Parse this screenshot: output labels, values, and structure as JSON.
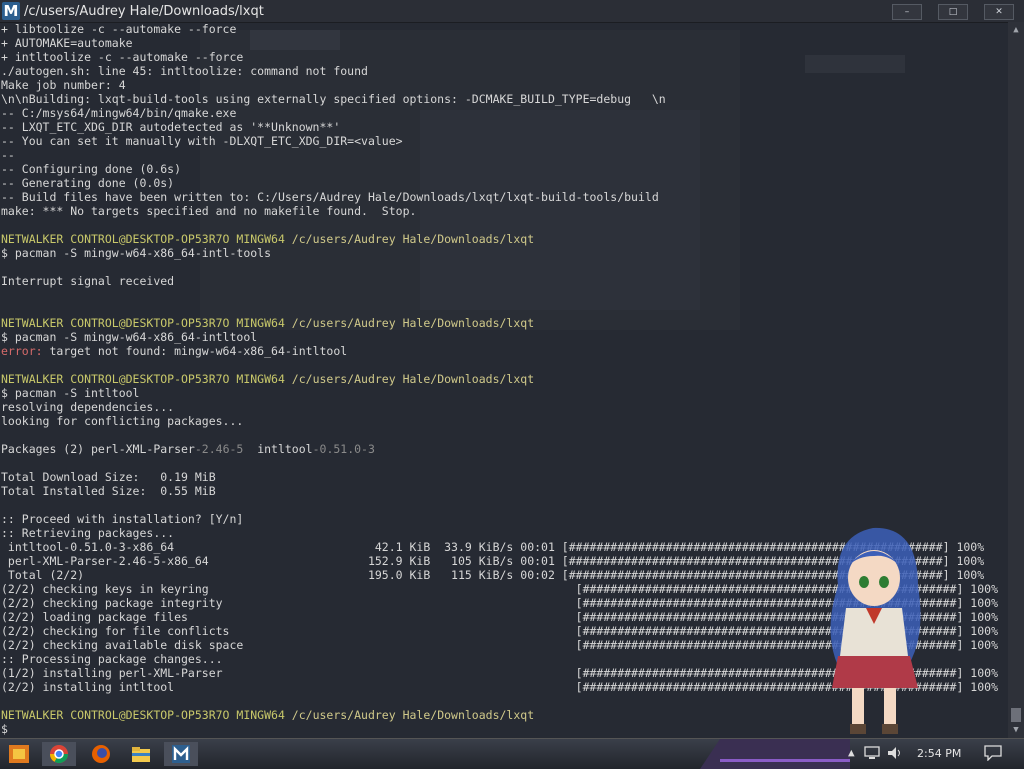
{
  "window": {
    "title": "/c/users/Audrey Hale/Downloads/lxqt",
    "logo_letter": "M",
    "minimize_label": "–",
    "maximize_label": "□",
    "close_label": "✕"
  },
  "terminal": {
    "lines": [
      {
        "segs": [
          {
            "t": "+ libtoolize -c --automake --force",
            "c": ""
          }
        ]
      },
      {
        "segs": [
          {
            "t": "+ AUTOMAKE=automake",
            "c": ""
          }
        ]
      },
      {
        "segs": [
          {
            "t": "+ intltoolize -c --automake --force",
            "c": ""
          }
        ]
      },
      {
        "segs": [
          {
            "t": "./autogen.sh: line 45: intltoolize: command not found",
            "c": ""
          }
        ]
      },
      {
        "segs": [
          {
            "t": "Make job number: 4",
            "c": ""
          }
        ]
      },
      {
        "segs": [
          {
            "t": "\\n\\nBuilding: lxqt-build-tools using externally specified options: -DCMAKE_BUILD_TYPE=debug   \\n",
            "c": ""
          }
        ]
      },
      {
        "segs": [
          {
            "t": "-- C:/msys64/mingw64/bin/qmake.exe",
            "c": ""
          }
        ]
      },
      {
        "segs": [
          {
            "t": "-- LXQT_ETC_XDG_DIR autodetected as '**Unknown**'",
            "c": ""
          }
        ]
      },
      {
        "segs": [
          {
            "t": "-- You can set it manually with -DLXQT_ETC_XDG_DIR=<value>",
            "c": ""
          }
        ]
      },
      {
        "segs": [
          {
            "t": "--",
            "c": ""
          }
        ]
      },
      {
        "segs": [
          {
            "t": "-- Configuring done (0.6s)",
            "c": ""
          }
        ]
      },
      {
        "segs": [
          {
            "t": "-- Generating done (0.0s)",
            "c": ""
          }
        ]
      },
      {
        "segs": [
          {
            "t": "-- Build files have been written to: C:/Users/Audrey Hale/Downloads/lxqt/lxqt-build-tools/build",
            "c": ""
          }
        ]
      },
      {
        "segs": [
          {
            "t": "make: *** No targets specified and no makefile found.  Stop.",
            "c": ""
          }
        ]
      },
      {
        "segs": [
          {
            "t": "",
            "c": ""
          }
        ]
      },
      {
        "segs": [
          {
            "t": "NETWALKER CONTROL@DESKTOP-OP53R7O MINGW64",
            "c": "c-prompt"
          },
          {
            "t": " /c/users/Audrey Hale/Downloads/lxqt",
            "c": "c-path"
          }
        ]
      },
      {
        "segs": [
          {
            "t": "$ pacman -S mingw-w64-x86_64-intl-tools",
            "c": ""
          }
        ]
      },
      {
        "segs": [
          {
            "t": "",
            "c": ""
          }
        ]
      },
      {
        "segs": [
          {
            "t": "Interrupt signal received",
            "c": ""
          }
        ]
      },
      {
        "segs": [
          {
            "t": "",
            "c": ""
          }
        ]
      },
      {
        "segs": [
          {
            "t": "",
            "c": ""
          }
        ]
      },
      {
        "segs": [
          {
            "t": "NETWALKER CONTROL@DESKTOP-OP53R7O MINGW64",
            "c": "c-prompt"
          },
          {
            "t": " /c/users/Audrey Hale/Downloads/lxqt",
            "c": "c-path"
          }
        ]
      },
      {
        "segs": [
          {
            "t": "$ pacman -S mingw-w64-x86_64-intltool",
            "c": ""
          }
        ]
      },
      {
        "segs": [
          {
            "t": "error:",
            "c": "c-err"
          },
          {
            "t": " target not found: mingw-w64-x86_64-intltool",
            "c": ""
          }
        ]
      },
      {
        "segs": [
          {
            "t": "",
            "c": ""
          }
        ]
      },
      {
        "segs": [
          {
            "t": "NETWALKER CONTROL@DESKTOP-OP53R7O MINGW64",
            "c": "c-prompt"
          },
          {
            "t": " /c/users/Audrey Hale/Downloads/lxqt",
            "c": "c-path"
          }
        ]
      },
      {
        "segs": [
          {
            "t": "$ pacman -S intltool",
            "c": ""
          }
        ]
      },
      {
        "segs": [
          {
            "t": "resolving dependencies...",
            "c": ""
          }
        ]
      },
      {
        "segs": [
          {
            "t": "looking for conflicting packages...",
            "c": ""
          }
        ]
      },
      {
        "segs": [
          {
            "t": "",
            "c": ""
          }
        ]
      },
      {
        "segs": [
          {
            "t": "Packages (2) perl-XML-Parser",
            "c": ""
          },
          {
            "t": "-2.46-5",
            "c": "c-ver"
          },
          {
            "t": "  intltool",
            "c": ""
          },
          {
            "t": "-0.51.0-3",
            "c": "c-ver"
          }
        ]
      },
      {
        "segs": [
          {
            "t": "",
            "c": ""
          }
        ]
      },
      {
        "segs": [
          {
            "t": "Total Download Size:   0.19 MiB",
            "c": ""
          }
        ]
      },
      {
        "segs": [
          {
            "t": "Total Installed Size:  0.55 MiB",
            "c": ""
          }
        ]
      },
      {
        "segs": [
          {
            "t": "",
            "c": ""
          }
        ]
      },
      {
        "segs": [
          {
            "t": ":: Proceed with installation? [Y/n]",
            "c": ""
          }
        ]
      },
      {
        "segs": [
          {
            "t": ":: Retrieving packages...",
            "c": ""
          }
        ]
      },
      {
        "segs": [
          {
            "t": " intltool-0.51.0-3-x86_64                             42.1 KiB  33.9 KiB/s 00:01 [######################################################] 100%",
            "c": ""
          }
        ]
      },
      {
        "segs": [
          {
            "t": " perl-XML-Parser-2.46-5-x86_64                       152.9 KiB   105 KiB/s 00:01 [######################################################] 100%",
            "c": ""
          }
        ]
      },
      {
        "segs": [
          {
            "t": " Total (2/2)                                         195.0 KiB   115 KiB/s 00:02 [######################################################] 100%",
            "c": ""
          }
        ]
      },
      {
        "segs": [
          {
            "t": "(2/2) checking keys in keyring                                                     [######################################################] 100%",
            "c": ""
          }
        ]
      },
      {
        "segs": [
          {
            "t": "(2/2) checking package integrity                                                   [######################################################] 100%",
            "c": ""
          }
        ]
      },
      {
        "segs": [
          {
            "t": "(2/2) loading package files                                                        [######################################################] 100%",
            "c": ""
          }
        ]
      },
      {
        "segs": [
          {
            "t": "(2/2) checking for file conflicts                                                  [######################################################] 100%",
            "c": ""
          }
        ]
      },
      {
        "segs": [
          {
            "t": "(2/2) checking available disk space                                                [######################################################] 100%",
            "c": ""
          }
        ]
      },
      {
        "segs": [
          {
            "t": ":: Processing package changes...",
            "c": ""
          }
        ]
      },
      {
        "segs": [
          {
            "t": "(1/2) installing perl-XML-Parser                                                   [######################################################] 100%",
            "c": ""
          }
        ]
      },
      {
        "segs": [
          {
            "t": "(2/2) installing intltool                                                          [######################################################] 100%",
            "c": ""
          }
        ]
      },
      {
        "segs": [
          {
            "t": "",
            "c": ""
          }
        ]
      },
      {
        "segs": [
          {
            "t": "NETWALKER CONTROL@DESKTOP-OP53R7O MINGW64",
            "c": "c-prompt"
          },
          {
            "t": " /c/users/Audrey Hale/Downloads/lxqt",
            "c": "c-path"
          }
        ]
      },
      {
        "segs": [
          {
            "t": "$",
            "c": ""
          }
        ]
      }
    ]
  },
  "scrollbar": {
    "up_arrow": "▲",
    "down_arrow": "▼"
  },
  "taskbar": {
    "clock": "2:54 PM",
    "icons": [
      "start-button-icon",
      "chrome-icon",
      "firefox-icon",
      "file-explorer-icon",
      "mintty-icon"
    ],
    "tray_icons": [
      "tray-arrow-icon",
      "network-icon",
      "volume-icon",
      "notification-icon"
    ]
  },
  "colors": {
    "terminal_bg": "#262a33",
    "prompt": "#c8c86a",
    "error": "#d46a6a",
    "taskbar": "#2a2d35"
  }
}
